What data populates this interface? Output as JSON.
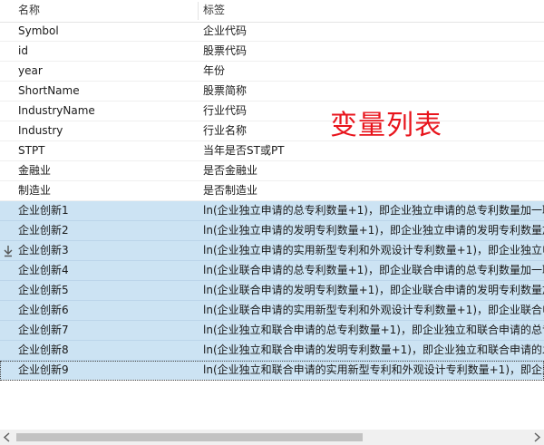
{
  "header": {
    "col_name": "名称",
    "col_label": "标签"
  },
  "overlay_title": "变量列表",
  "rows": [
    {
      "name": "Symbol",
      "label": "企业代码"
    },
    {
      "name": "id",
      "label": "股票代码"
    },
    {
      "name": "year",
      "label": "年份"
    },
    {
      "name": "ShortName",
      "label": "股票简称"
    },
    {
      "name": "IndustryName",
      "label": "行业代码"
    },
    {
      "name": "Industry",
      "label": "行业名称"
    },
    {
      "name": "STPT",
      "label": "当年是否ST或PT"
    },
    {
      "name": "金融业",
      "label": "是否金融业"
    },
    {
      "name": "制造业",
      "label": "是否制造业"
    },
    {
      "name": "企业创新1",
      "label": "ln(企业独立申请的总专利数量+1)，即企业独立申请的总专利数量加一取"
    },
    {
      "name": "企业创新2",
      "label": "ln(企业独立申请的发明专利数量+1)，即企业独立申请的发明专利数量加"
    },
    {
      "name": "企业创新3",
      "label": "ln(企业独立申请的实用新型专利和外观设计专利数量+1)，即企业独立申"
    },
    {
      "name": "企业创新4",
      "label": "ln(企业联合申请的总专利数量+1)，即企业联合申请的总专利数量加一取"
    },
    {
      "name": "企业创新5",
      "label": "ln(企业联合申请的发明专利数量+1)，即企业联合申请的发明专利数量加"
    },
    {
      "name": "企业创新6",
      "label": "ln(企业联合申请的实用新型专利和外观设计专利数量+1)，即企业联合申"
    },
    {
      "name": "企业创新7",
      "label": "ln(企业独立和联合申请的总专利数量+1)，即企业独立和联合申请的总专"
    },
    {
      "name": "企业创新8",
      "label": "ln(企业独立和联合申请的发明专利数量+1)，即企业独立和联合申请的发"
    },
    {
      "name": "企业创新9",
      "label": "ln(企业独立和联合申请的实用新型专利和外观设计专利数量+1)，即企业"
    }
  ],
  "icons": {
    "row_marker": "down-arrow-icon",
    "scroll_left": "chevron-left-icon",
    "scroll_right": "chevron-right-icon"
  },
  "colors": {
    "selection": "#cce3f3",
    "title": "#e8141c"
  }
}
